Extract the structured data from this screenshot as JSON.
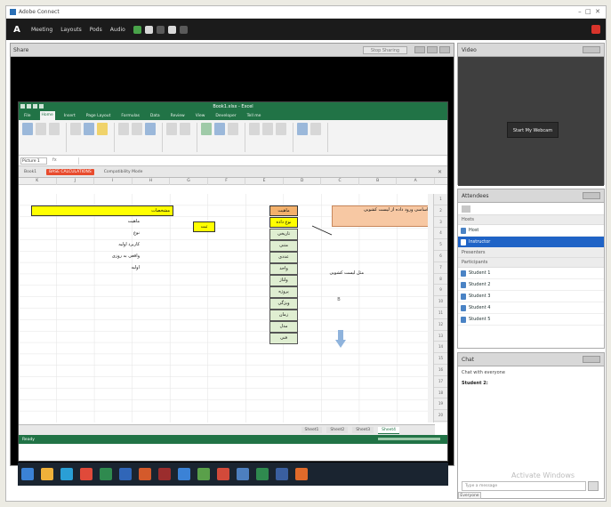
{
  "window": {
    "title": "Adobe Connect"
  },
  "menubar": {
    "items": [
      "Meeting",
      "Layouts",
      "Pods",
      "Audio"
    ]
  },
  "share": {
    "title": "Share",
    "stop_label": "Stop Sharing"
  },
  "excel": {
    "title_bar": "Book1.xlsx - Excel",
    "tabs": [
      "File",
      "Home",
      "Insert",
      "Page Layout",
      "Formulas",
      "Data",
      "Review",
      "View",
      "Developer",
      "Tell me"
    ],
    "active_tab": "Home",
    "namebox": "Picture 1",
    "fx": "fx",
    "doc_tabs": [
      "Book1",
      "BASE CALCULATIONS",
      "Compatibility Mode"
    ],
    "columns": [
      "A",
      "B",
      "C",
      "D",
      "E",
      "F",
      "G",
      "H",
      "I",
      "J",
      "K"
    ],
    "rows": [
      "1",
      "2",
      "3",
      "4",
      "5",
      "6",
      "7",
      "8",
      "9",
      "10",
      "11",
      "12",
      "13",
      "14",
      "15",
      "16",
      "17",
      "18",
      "19",
      "20"
    ],
    "cells": {
      "header_yellow": "مشخصات",
      "left_list": [
        "ماهیت",
        "نوع",
        "کاربرد اولیه",
        "واقعی به روزی",
        "اولیه"
      ],
      "mid_yellow": "ثبت",
      "orange_head": "ماهیت",
      "yellow_sub": "نوع داده",
      "green_list": [
        "تاریخی",
        "متنی",
        "عددی",
        "واحد",
        "ولتاژ",
        "پروژه",
        "ویژگی",
        "زمان",
        "مدل",
        "فنی"
      ],
      "callout": "روش اساسی ورود داده از لیست کشویی",
      "note_below": "مثل لیست کشویی",
      "small_mark": "B"
    },
    "sheet_tabs": [
      "Sheet1",
      "Sheet2",
      "Sheet3",
      "Sheet4"
    ],
    "active_sheet": "Sheet4",
    "status": "Ready"
  },
  "video": {
    "title": "Video",
    "start_label": "Start My Webcam"
  },
  "attendees": {
    "title": "Attendees",
    "groups": [
      "Hosts",
      "Presenters",
      "Participants"
    ],
    "hosts": [
      "Host",
      "Instructor"
    ],
    "participants": [
      "Student 1",
      "Student 2",
      "Student 3",
      "Student 4",
      "Student 5"
    ]
  },
  "chat": {
    "title": "Chat",
    "info": "Chat with everyone",
    "sender": "Student 2:",
    "input_placeholder": "Type a message",
    "tab_label": "Everyone",
    "watermark": "Activate Windows"
  },
  "colors": {
    "excel_green": "#217346",
    "accent_blue": "#1f63c6",
    "highlight_yellow": "#ffff00",
    "callout_orange": "#f7c8a3"
  }
}
